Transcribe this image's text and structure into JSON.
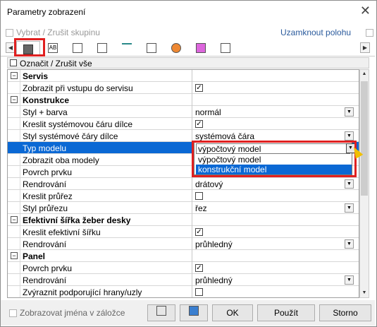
{
  "window": {
    "title": "Parametry zobrazení",
    "close_glyph": "✕"
  },
  "topbar": {
    "select_group": "Vybrat / Zrušit skupinu",
    "lock_position": "Uzamknout polohu"
  },
  "tabs": [
    "table-icon",
    "text-ab-icon",
    "triangle-icon",
    "calc-icon",
    "axis-icon",
    "chart-icon",
    "palette-icon",
    "pencil-icon",
    "search-icon"
  ],
  "tab_labels": [
    "AB"
  ],
  "nav": {
    "left": "◀",
    "right": "▶"
  },
  "header": {
    "label": "Označit / Zrušit vše"
  },
  "rows": [
    {
      "name": "Servis",
      "group": true,
      "exp": "−"
    },
    {
      "name": "Zobrazit při vstupu do servisu",
      "check": true
    },
    {
      "name": "Konstrukce",
      "group": true,
      "exp": "−"
    },
    {
      "name": "Styl + barva",
      "value": "normál",
      "dropdown": true
    },
    {
      "name": "Kreslit systémovou čáru dílce",
      "check": true
    },
    {
      "name": "Styl systémové čáry dílce",
      "value": "systémová čára",
      "dropdown": true
    },
    {
      "name": "Typ modelu",
      "selected": true
    },
    {
      "name": "Zobrazit oba modely"
    },
    {
      "name": "Povrch prvku"
    },
    {
      "name": "Rendrování",
      "value": "drátový",
      "dropdown": true
    },
    {
      "name": "Kreslit průřez",
      "check": false
    },
    {
      "name": "Styl průřezu",
      "value": "řez",
      "dropdown": true
    },
    {
      "name": "Efektivní šířka žeber desky",
      "group": true,
      "exp": "−"
    },
    {
      "name": "Kreslit efektivní šířku",
      "check": true
    },
    {
      "name": "Rendrování",
      "value": "průhledný",
      "dropdown": true
    },
    {
      "name": "Panel",
      "group": true,
      "exp": "−"
    },
    {
      "name": "Povrch prvku",
      "check": true
    },
    {
      "name": "Rendrování",
      "value": "průhledný",
      "dropdown": true
    },
    {
      "name": "Zvýraznit podporující hrany/uzly",
      "check": false
    }
  ],
  "popup": {
    "current": "výpočtový model",
    "options": [
      "výpočtový model",
      "konstrukční model"
    ],
    "highlighted": "konstrukční model"
  },
  "bottom": {
    "show_names": "Zobrazovat jména v záložce",
    "ok": "OK",
    "apply": "Použít",
    "cancel": "Storno"
  },
  "colors": {
    "accent": "#0a68d4",
    "highlight_box": "#e02020"
  }
}
